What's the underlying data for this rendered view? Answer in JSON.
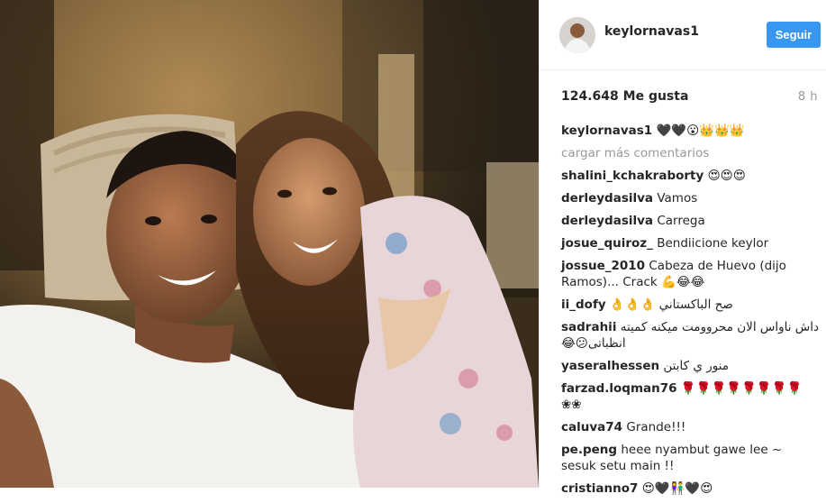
{
  "post": {
    "username": "keylornavas1",
    "follow_label": "Seguir",
    "likes": "124.648 Me gusta",
    "time": "8 h"
  },
  "caption": {
    "username": "keylornavas1",
    "text": "🖤🖤😮👑👑👑"
  },
  "load_more": "cargar más comentarios",
  "comments": [
    {
      "user": "shalini_kchakraborty",
      "text": "😍😍😍"
    },
    {
      "user": "derleydasilva",
      "text": "Vamos"
    },
    {
      "user": "derleydasilva",
      "text": "Carrega"
    },
    {
      "user": "josue_quiroz_",
      "text": "Bendiicione keylor"
    },
    {
      "user": "jossue_2010",
      "text": "Cabeza de Huevo (dijo Ramos)... Crack 💪😂😂"
    },
    {
      "user": "ii_dofy",
      "text": "صح الباكستاني 👌👌👌"
    },
    {
      "user": "sadrahii",
      "text": "داش ناواس الان محروومت میکنه کمیته انظباتی😕😂"
    },
    {
      "user": "yaseralhessen",
      "text": "منور ي كابتن"
    },
    {
      "user": "farzad.loqman76",
      "text": "🌹🌹🌹🌹🌹🌹🌹🌹 ❀❀"
    },
    {
      "user": "caluva74",
      "text": "Grande!!!"
    },
    {
      "user": "pe.peng",
      "text": "heee nyambut gawe lee ~ sesuk setu main !!"
    },
    {
      "user": "cristianno7",
      "text": "😍🖤👫🖤😍"
    }
  ]
}
